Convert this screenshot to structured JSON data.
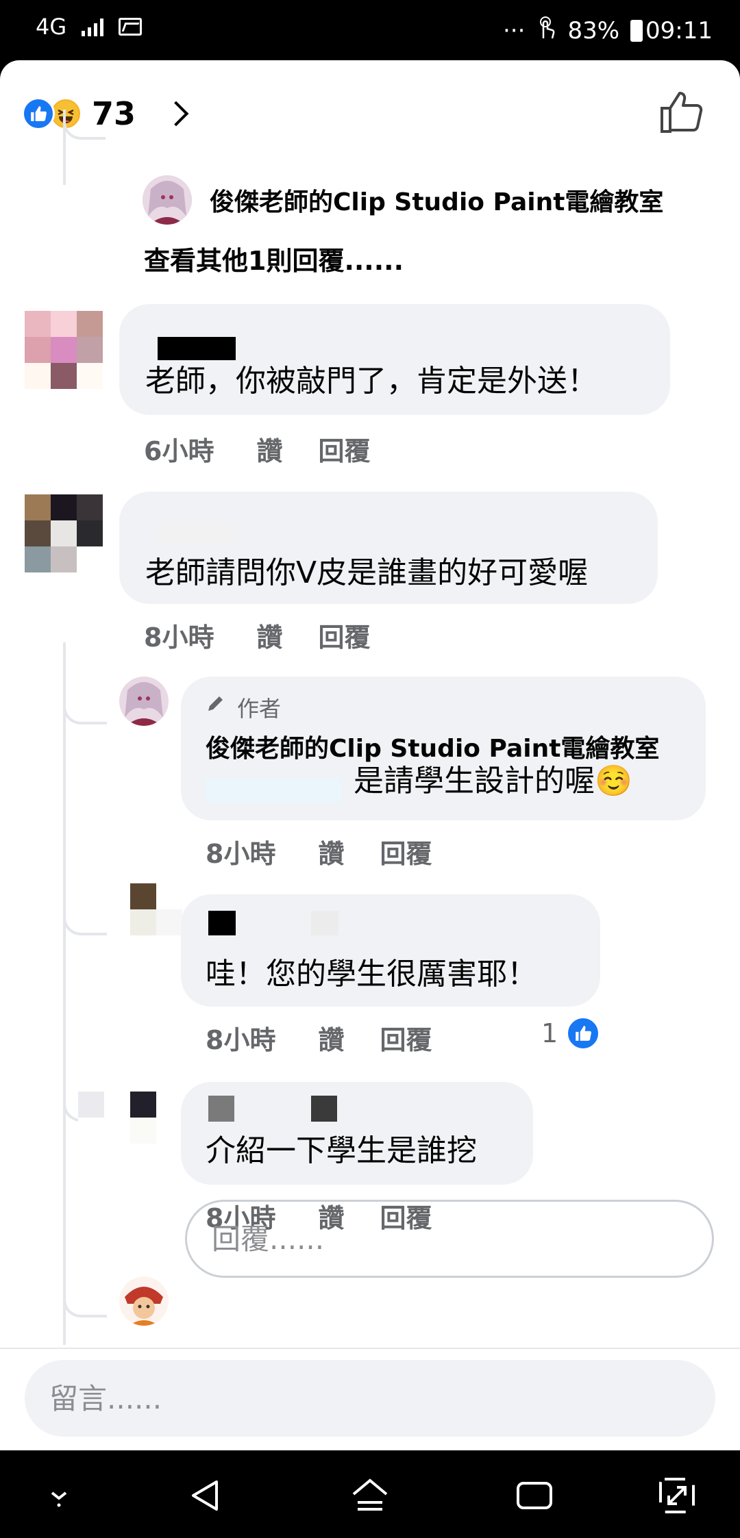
{
  "status_bar": {
    "network": "4G",
    "overflow": "···",
    "battery": "83%",
    "time": "09:11"
  },
  "reactions": {
    "icons": [
      "like-icon",
      "haha-icon"
    ],
    "count": "73"
  },
  "comments": [
    {
      "author": "俊傑老師的Clip Studio Paint電繪教室",
      "more_replies": "查看其他1則回覆......"
    },
    {
      "text": "老師，你被敲門了，肯定是外送！",
      "time": "6小時",
      "like": "讚",
      "reply": "回覆"
    },
    {
      "text": "老師請問你V皮是誰畫的好可愛喔",
      "time": "8小時",
      "like": "讚",
      "reply": "回覆"
    }
  ],
  "replies": [
    {
      "badge": "作者",
      "author": "俊傑老師的Clip Studio Paint電繪教室",
      "text": "是請學生設計的喔☺️",
      "time": "8小時",
      "like": "讚",
      "reply": "回覆"
    },
    {
      "text": "哇！您的學生很厲害耶！",
      "time": "8小時",
      "like": "讚",
      "reply": "回覆",
      "like_count": "1"
    },
    {
      "text": "介紹一下學生是誰挖",
      "time": "8小時",
      "like": "讚",
      "reply": "回覆"
    }
  ],
  "reply_input": {
    "placeholder": "回覆......"
  },
  "comment_input": {
    "placeholder": "留言......"
  },
  "colors": {
    "accent": "#1877f2",
    "bubble": "#f0f2f5",
    "meta_text": "#65676b"
  }
}
